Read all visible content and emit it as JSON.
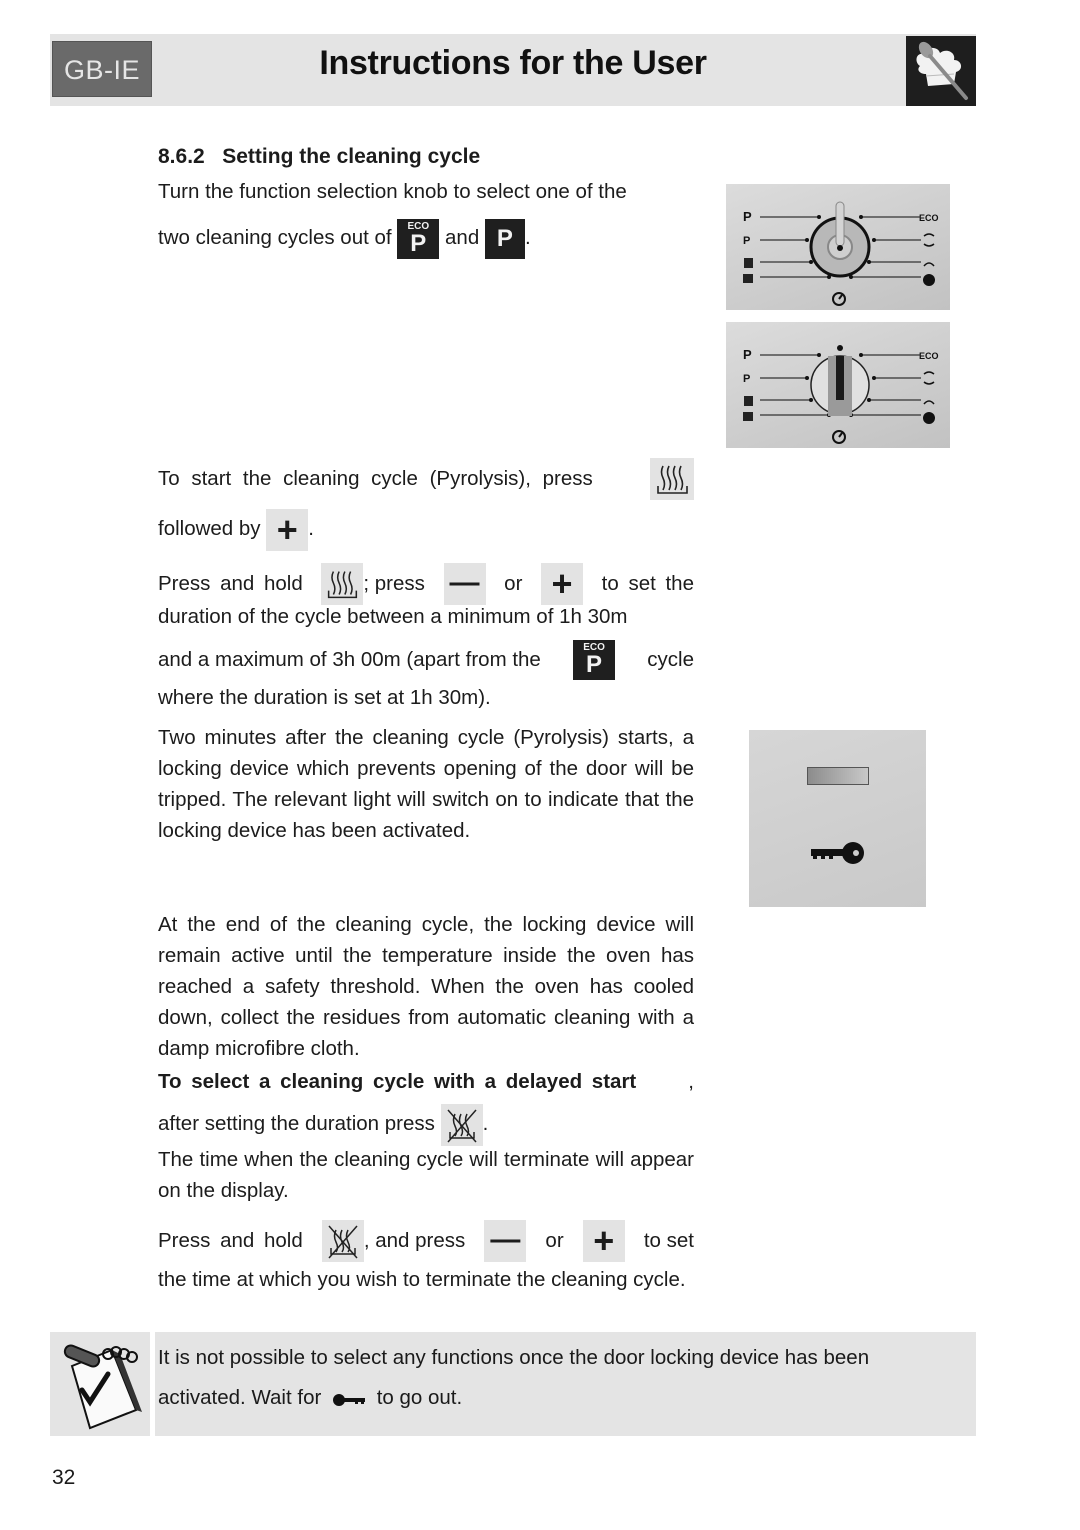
{
  "header": {
    "language_badge": "GB-IE",
    "title": "Instructions for the User",
    "logo_icon": "chef-hat-spoon-icon"
  },
  "section": {
    "number": "8.6.2",
    "title": "Setting the cleaning cycle"
  },
  "paragraphs": {
    "p1_a": "Turn the function selection knob to select one of the",
    "p1_b": "two cleaning cycles out of",
    "p1_and": "and",
    "p1_end": ".",
    "p2_a": "To start the cleaning cycle (Pyrolysis), press",
    "p2_b": "followed by",
    "p2_end": ".",
    "p3_a": "Press and hold",
    "p3_b": "; press",
    "p3_or": "or",
    "p3_c": "to set the",
    "p3_d": "duration of the cycle between a minimum of 1h 30m",
    "p3_e": "and a maximum of 3h 00m (apart from the",
    "p3_f": "cycle",
    "p3_g": "where the duration is set at 1h 30m).",
    "p4": "Two minutes after the cleaning cycle (Pyrolysis) starts, a locking device which prevents opening of the door will be tripped. The relevant light will switch on to indicate that the locking device has been activated.",
    "p5": "At the end of the cleaning cycle, the locking device will remain active until the temperature inside the oven has reached a safety threshold. When the oven has cooled down, collect the residues from automatic cleaning with a damp microfibre cloth.",
    "p6_bold": "To select a cleaning cycle with a delayed start",
    "p6_comma": ",",
    "p6_b": "after setting the duration press",
    "p6_end": ".",
    "p7": "The time when the cleaning cycle will terminate will appear on the display.",
    "p8_a": "Press and hold",
    "p8_b": ", and press",
    "p8_or": "or",
    "p8_c": "to set",
    "p8_d": "the time at which you wish to terminate the cleaning cycle."
  },
  "icons": {
    "eco_label": "ECO",
    "p_label": "P",
    "plus": "+",
    "minus": "—"
  },
  "knob_figure": {
    "left_labels": [
      "P",
      "P",
      "♨",
      "♨"
    ],
    "right_labels": [
      "ECO",
      "",
      "",
      ""
    ]
  },
  "note": {
    "line1": "It is not possible to select any functions once the door locking device has been",
    "line2_a": "activated. Wait for",
    "line2_b": "to go out."
  },
  "footer": {
    "page_number": "32"
  }
}
